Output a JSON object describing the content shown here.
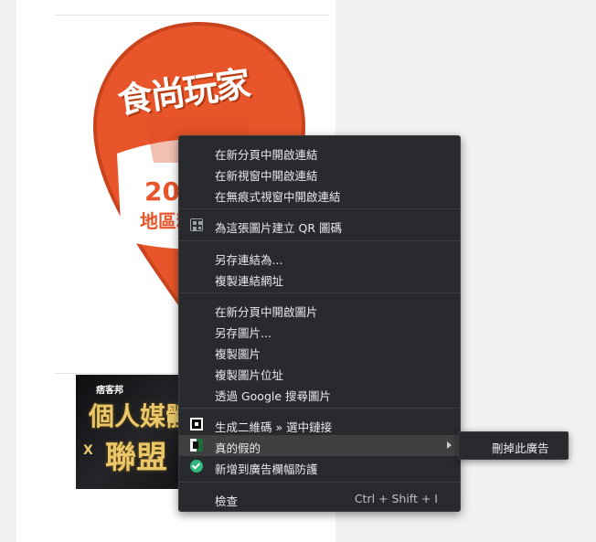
{
  "page": {
    "logo": {
      "title": "食尚玩家",
      "year": "20",
      "subtitle": "地區精"
    },
    "ad": {
      "brand": "痞客邦",
      "line1": "個人媒體",
      "line2": "聯盟",
      "x_mark": "X"
    }
  },
  "context_menu": {
    "items": [
      {
        "label": "在新分頁中開啟連結"
      },
      {
        "label": "在新視窗中開啟連結"
      },
      {
        "label": "在無痕式視窗中開啟連結"
      },
      {
        "label": "為這張圖片建立 QR 圖碼",
        "icon": "qr-code-icon"
      },
      {
        "label": "另存連結為..."
      },
      {
        "label": "複製連結網址"
      },
      {
        "label": "在新分頁中開啟圖片"
      },
      {
        "label": "另存圖片..."
      },
      {
        "label": "複製圖片"
      },
      {
        "label": "複製圖片位址"
      },
      {
        "label": "透過 Google 搜尋圖片"
      },
      {
        "label": "生成二維碼 » 選中鏈接",
        "icon": "qr-generator-icon"
      },
      {
        "label": "真的假的",
        "icon": "fake-news-icon",
        "has_submenu": true
      },
      {
        "label": "新增到廣告欄幅防護",
        "icon": "shield-check-icon"
      },
      {
        "label": "檢查",
        "shortcut": "Ctrl + Shift + I"
      }
    ],
    "submenu": {
      "items": [
        {
          "label": "刪掉此廣告"
        }
      ]
    }
  },
  "colors": {
    "menu_bg": "#292a2d",
    "menu_text": "#e8eaed",
    "highlight": "#3f4042",
    "logo_orange": "#e8552a",
    "shield_green": "#2fb77c"
  }
}
